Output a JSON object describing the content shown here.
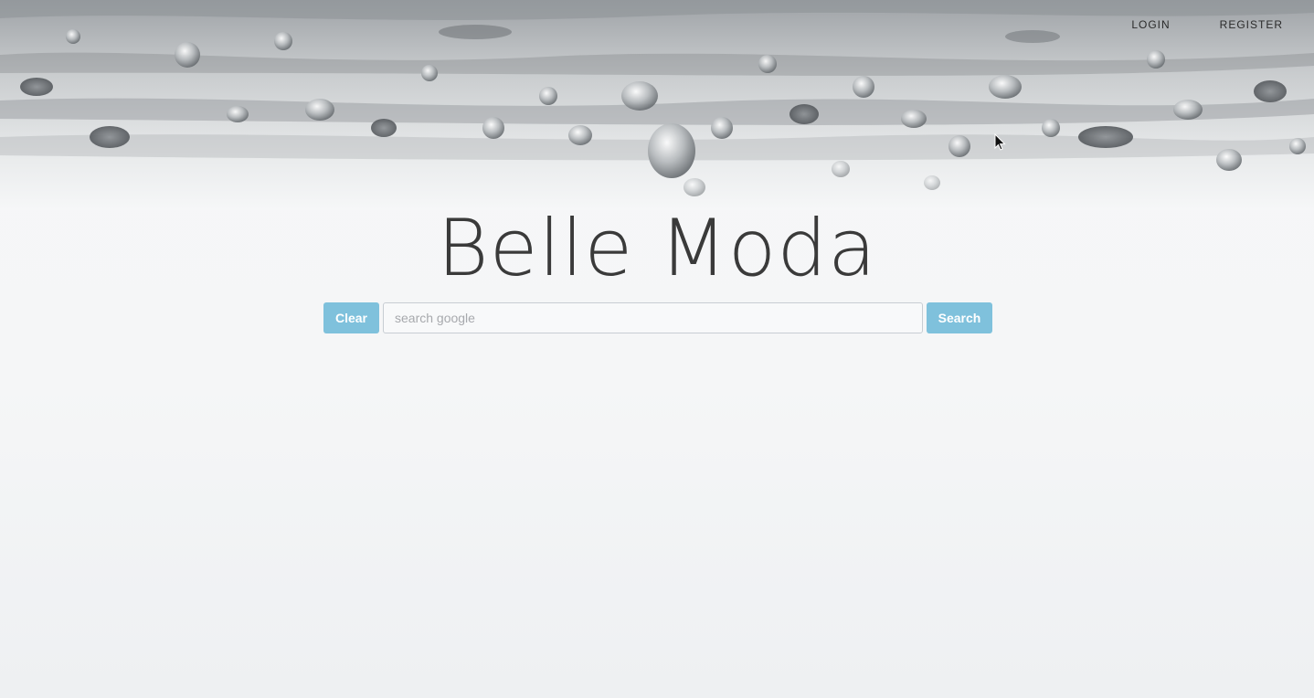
{
  "nav": {
    "login_label": "LOGIN",
    "register_label": "REGISTER"
  },
  "hero": {
    "image": "water-splash-background"
  },
  "brand": {
    "title": "Belle Moda"
  },
  "search": {
    "clear_label": "Clear",
    "placeholder": "search google",
    "value": "",
    "submit_label": "Search"
  },
  "colors": {
    "button_accent": "#7fc1dc",
    "page_background": "#f5f6f7",
    "title_text": "#3a3a3a"
  }
}
